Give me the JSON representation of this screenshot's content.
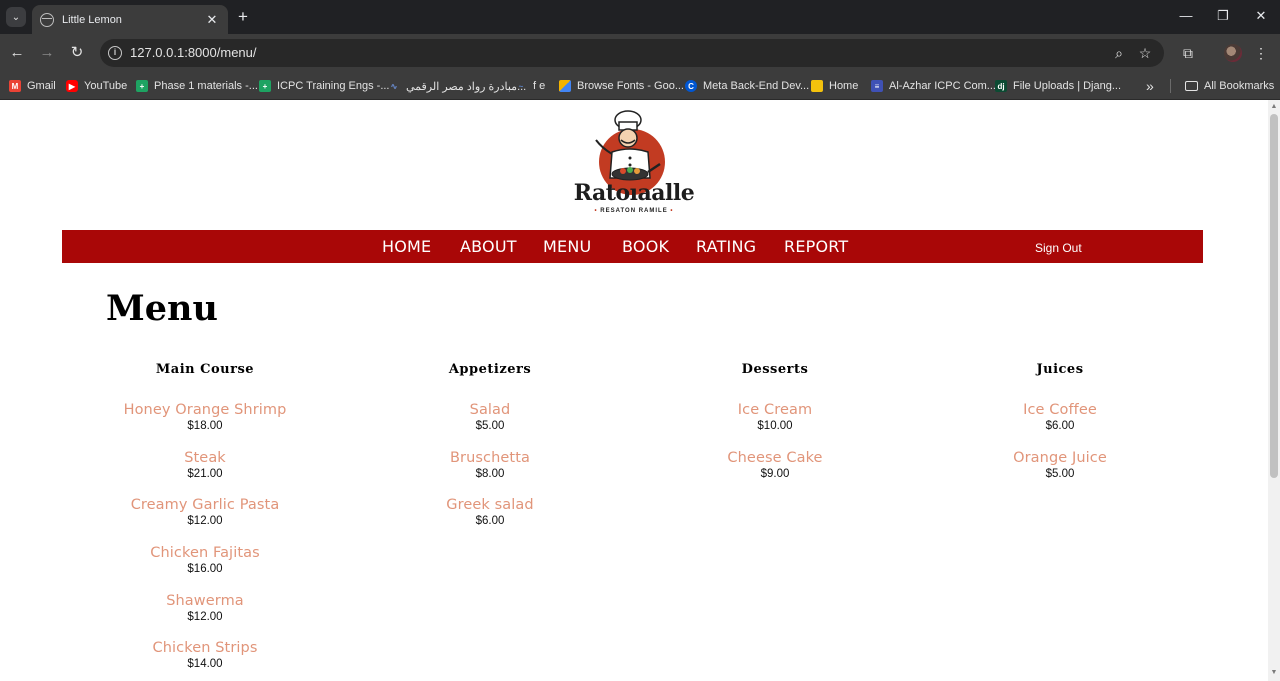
{
  "browser": {
    "tab_title": "Little Lemon",
    "url": "127.0.0.1:8000/menu/",
    "bookmarks": [
      {
        "label": "Gmail",
        "icon": "gmail-icon",
        "color": "#ea4335"
      },
      {
        "label": "YouTube",
        "icon": "youtube-icon",
        "color": "#ff0000"
      },
      {
        "label": "Phase 1 materials -...",
        "icon": "sheets-icon",
        "color": "#1ea362"
      },
      {
        "label": "ICPC Training Engs -...",
        "icon": "sheets-icon",
        "color": "#1ea362"
      },
      {
        "label": "مبادرة رواد مصر الرقمي...",
        "icon": "chart-icon",
        "color": "#6b8fd6"
      },
      {
        "label": "f e",
        "icon": "web-icon",
        "color": "#5b7fbd"
      },
      {
        "label": "Browse Fonts - Goo...",
        "icon": "fonts-icon",
        "color": "#f4b400"
      },
      {
        "label": "Meta Back-End Dev...",
        "icon": "coursera-icon",
        "color": "#0056d2"
      },
      {
        "label": "Home",
        "icon": "home-icon",
        "color": "#f4c20d"
      },
      {
        "label": "Al-Azhar ICPC Com...",
        "icon": "forms-icon",
        "color": "#3f51b5"
      },
      {
        "label": "File Uploads | Djang...",
        "icon": "django-icon",
        "color": "#0c4b33"
      }
    ],
    "all_bookmarks": "All Bookmarks"
  },
  "site": {
    "logo_text": "Ratoıaalle",
    "logo_sub": "RESATON RAMILE",
    "nav": [
      "HOME",
      "ABOUT",
      "MENU",
      "BOOK",
      "RATING",
      "REPORT"
    ],
    "sign_out": "Sign Out",
    "heading": "Menu"
  },
  "menu": [
    {
      "title": "Main Course",
      "items": [
        {
          "name": "Honey Orange Shrimp",
          "price": "$18.00"
        },
        {
          "name": "Steak",
          "price": "$21.00"
        },
        {
          "name": "Creamy Garlic Pasta",
          "price": "$12.00"
        },
        {
          "name": "Chicken Fajitas",
          "price": "$16.00"
        },
        {
          "name": "Shawerma",
          "price": "$12.00"
        },
        {
          "name": "Chicken Strips",
          "price": "$14.00"
        }
      ]
    },
    {
      "title": "Appetizers",
      "items": [
        {
          "name": "Salad",
          "price": "$5.00"
        },
        {
          "name": "Bruschetta",
          "price": "$8.00"
        },
        {
          "name": "Greek salad",
          "price": "$6.00"
        }
      ]
    },
    {
      "title": "Desserts",
      "items": [
        {
          "name": "Ice Cream",
          "price": "$10.00"
        },
        {
          "name": "Cheese Cake",
          "price": "$9.00"
        }
      ]
    },
    {
      "title": "Juices",
      "items": [
        {
          "name": "Ice Coffee",
          "price": "$6.00"
        },
        {
          "name": "Orange Juice",
          "price": "$5.00"
        }
      ]
    }
  ],
  "colors": {
    "nav_bar": "#a90707",
    "item_name": "#e1957a",
    "browser_dark": "#202124"
  }
}
